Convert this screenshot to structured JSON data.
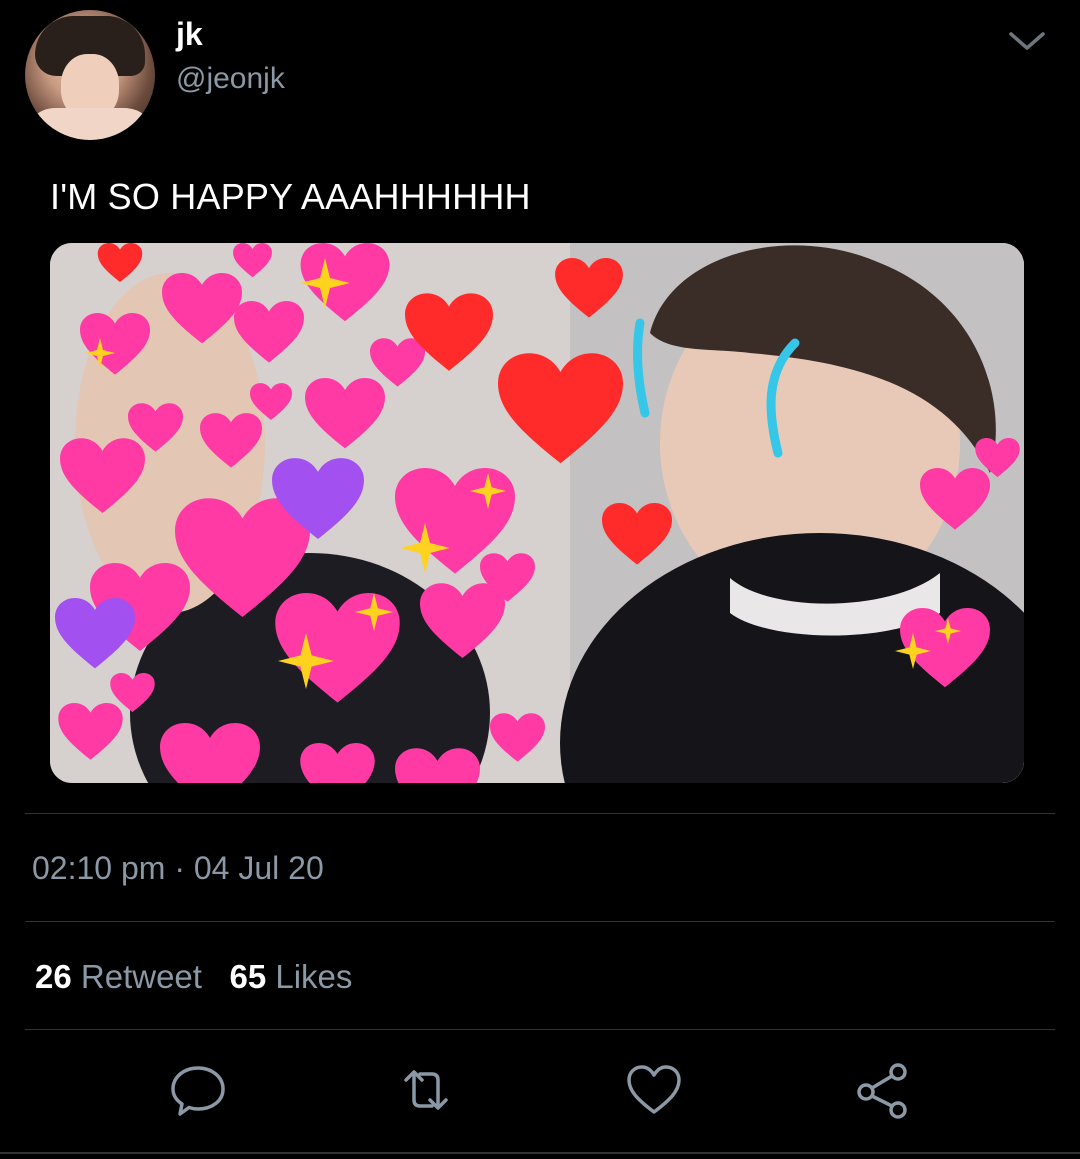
{
  "author": {
    "display_name": "jk",
    "handle": "@jeonjk"
  },
  "tweet": {
    "text": "I'M SO HAPPY AAAHHHHHH",
    "time": "02:10 pm",
    "separator": " · ",
    "date": "04 Jul 20"
  },
  "stats": {
    "retweet_count": "26",
    "retweet_label": "Retweet",
    "like_count": "65",
    "like_label": "Likes"
  },
  "icons": {
    "menu": "chevron-down-icon",
    "reply": "reply-icon",
    "retweet": "retweet-icon",
    "like": "heart-icon",
    "share": "share-icon"
  },
  "colors": {
    "background": "#000000",
    "primary_text": "#ffffff",
    "secondary_text": "#8b98a5",
    "divider": "#2f3336"
  }
}
